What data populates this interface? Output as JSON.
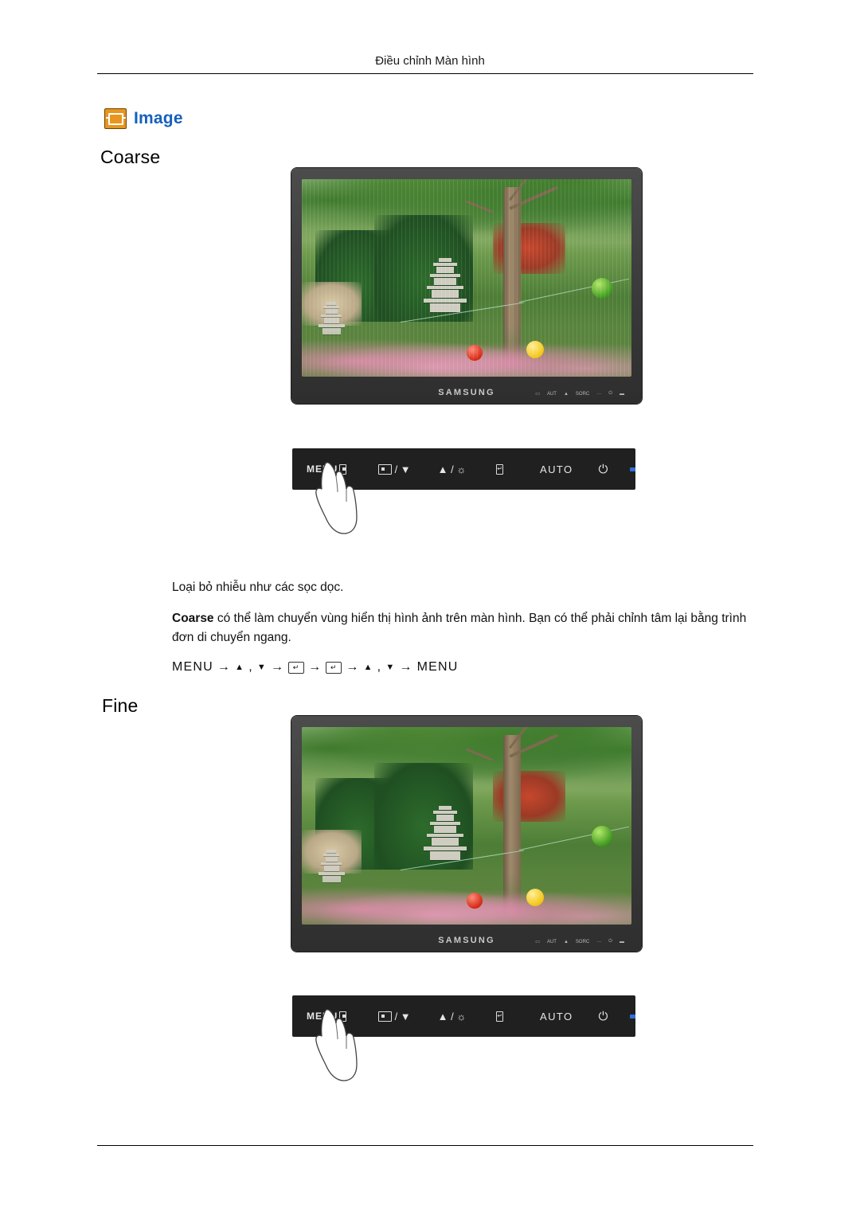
{
  "header": {
    "running_title": "Điều chỉnh Màn hình"
  },
  "section": {
    "icon": "image-icon",
    "label": "Image"
  },
  "headings": {
    "coarse": "Coarse",
    "fine": "Fine"
  },
  "body": {
    "line1": "Loại bỏ nhiễu như các sọc dọc.",
    "line2_bold": "Coarse",
    "line2_rest": " có thể làm chuyển vùng hiển thị hình ảnh trên màn hình. Bạn có thể phải chỉnh tâm lại bằng trình đơn di chuyển ngang."
  },
  "nav_sequence": {
    "menu": "MENU",
    "arrow": "→",
    "up": "▲",
    "comma": ",",
    "down": "▼",
    "enter": "↵",
    "menu_end": "MENU"
  },
  "monitor": {
    "brand": "SAMSUNG",
    "bezel_buttons": [
      "MENU",
      "AUTO",
      "▲",
      "SOURCE",
      "···",
      "⏻",
      "▬"
    ]
  },
  "control_panel": {
    "menu_label": "MENU",
    "key_source": "/ ▼",
    "key_bright": "▲ / ☼",
    "key_enter": "",
    "auto_label": "AUTO",
    "power_glyph": "⏻",
    "led_color": "#2f6fd8"
  },
  "colors": {
    "accent_blue": "#1560bd",
    "icon_orange": "#e8961f",
    "panel_black": "#202020"
  }
}
